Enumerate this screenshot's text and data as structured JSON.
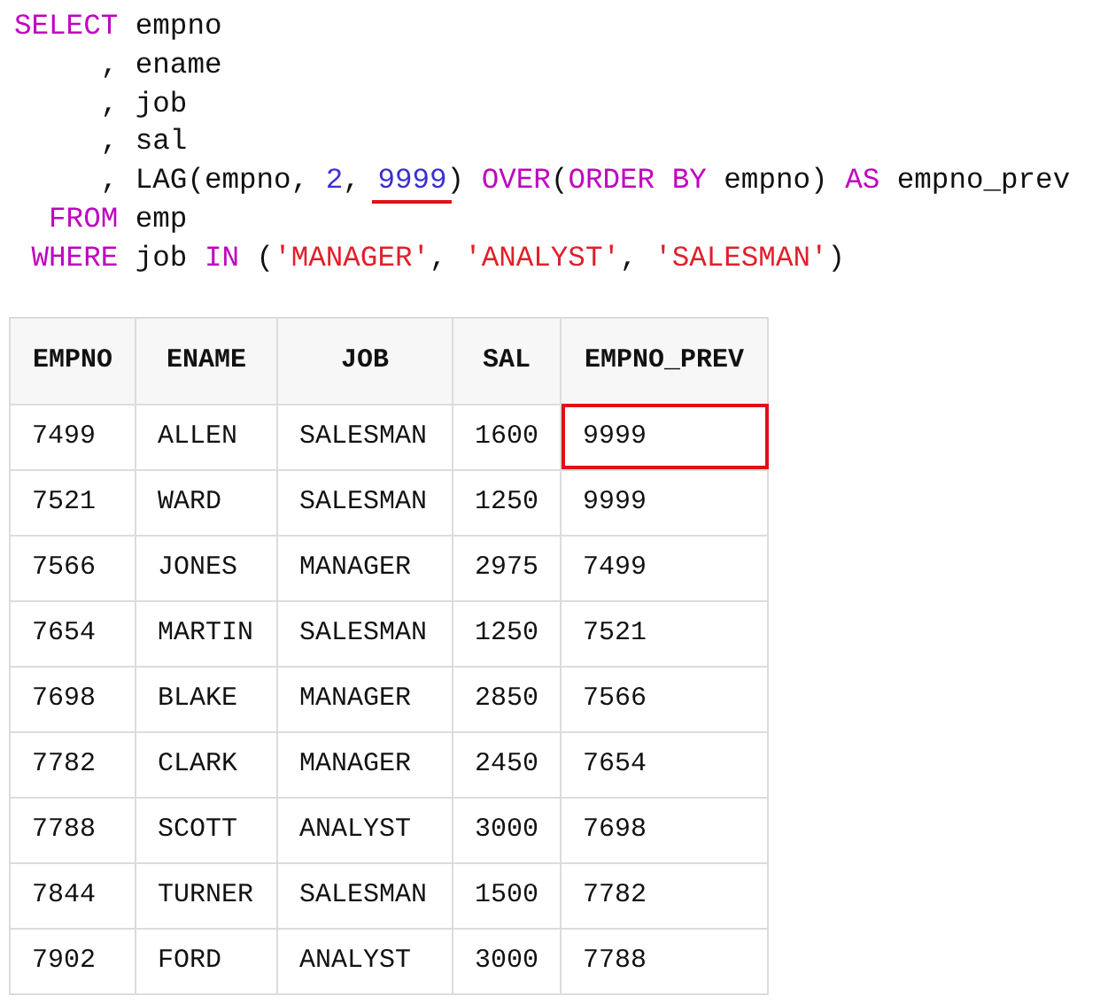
{
  "code": {
    "lines": [
      {
        "tokens": [
          {
            "kind": "keyword",
            "text": "SELECT"
          },
          {
            "kind": "plain",
            "text": " empno"
          }
        ]
      },
      {
        "tokens": [
          {
            "kind": "plain",
            "text": "     , ename"
          }
        ]
      },
      {
        "tokens": [
          {
            "kind": "plain",
            "text": "     , job"
          }
        ]
      },
      {
        "tokens": [
          {
            "kind": "plain",
            "text": "     , sal"
          }
        ]
      },
      {
        "tokens": [
          {
            "kind": "plain",
            "text": "     , LAG(empno, "
          },
          {
            "kind": "number",
            "text": "2"
          },
          {
            "kind": "plain",
            "text": ", "
          },
          {
            "kind": "number",
            "text": "9999",
            "underlined": true
          },
          {
            "kind": "plain",
            "text": ") "
          },
          {
            "kind": "keyword",
            "text": "OVER"
          },
          {
            "kind": "plain",
            "text": "("
          },
          {
            "kind": "keyword",
            "text": "ORDER BY"
          },
          {
            "kind": "plain",
            "text": " empno) "
          },
          {
            "kind": "keyword",
            "text": "AS"
          },
          {
            "kind": "plain",
            "text": " empno_prev"
          }
        ]
      },
      {
        "tokens": [
          {
            "kind": "keyword",
            "text": "  FROM"
          },
          {
            "kind": "plain",
            "text": " emp"
          }
        ]
      },
      {
        "tokens": [
          {
            "kind": "keyword",
            "text": " WHERE"
          },
          {
            "kind": "plain",
            "text": " job "
          },
          {
            "kind": "keyword",
            "text": "IN"
          },
          {
            "kind": "plain",
            "text": " ("
          },
          {
            "kind": "string",
            "text": "'MANAGER'"
          },
          {
            "kind": "plain",
            "text": ", "
          },
          {
            "kind": "string",
            "text": "'ANALYST'"
          },
          {
            "kind": "plain",
            "text": ", "
          },
          {
            "kind": "string",
            "text": "'SALESMAN'"
          },
          {
            "kind": "plain",
            "text": ")"
          }
        ]
      }
    ]
  },
  "table": {
    "columns": [
      "EMPNO",
      "ENAME",
      "JOB",
      "SAL",
      "EMPNO_PREV"
    ],
    "rows": [
      {
        "cells": [
          {
            "text": "7499"
          },
          {
            "text": "ALLEN"
          },
          {
            "text": "SALESMAN"
          },
          {
            "text": "1600"
          },
          {
            "text": "9999",
            "highlighted": true
          }
        ]
      },
      {
        "cells": [
          {
            "text": "7521"
          },
          {
            "text": "WARD"
          },
          {
            "text": "SALESMAN"
          },
          {
            "text": "1250"
          },
          {
            "text": "9999",
            "highlighted": false
          }
        ]
      },
      {
        "cells": [
          {
            "text": "7566"
          },
          {
            "text": "JONES"
          },
          {
            "text": "MANAGER"
          },
          {
            "text": "2975"
          },
          {
            "text": "7499",
            "highlighted": false
          }
        ]
      },
      {
        "cells": [
          {
            "text": "7654"
          },
          {
            "text": "MARTIN"
          },
          {
            "text": "SALESMAN"
          },
          {
            "text": "1250"
          },
          {
            "text": "7521",
            "highlighted": false
          }
        ]
      },
      {
        "cells": [
          {
            "text": "7698"
          },
          {
            "text": "BLAKE"
          },
          {
            "text": "MANAGER"
          },
          {
            "text": "2850"
          },
          {
            "text": "7566",
            "highlighted": false
          }
        ]
      },
      {
        "cells": [
          {
            "text": "7782"
          },
          {
            "text": "CLARK"
          },
          {
            "text": "MANAGER"
          },
          {
            "text": "2450"
          },
          {
            "text": "7654",
            "highlighted": false
          }
        ]
      },
      {
        "cells": [
          {
            "text": "7788"
          },
          {
            "text": "SCOTT"
          },
          {
            "text": "ANALYST"
          },
          {
            "text": "3000"
          },
          {
            "text": "7698",
            "highlighted": false
          }
        ]
      },
      {
        "cells": [
          {
            "text": "7844"
          },
          {
            "text": "TURNER"
          },
          {
            "text": "SALESMAN"
          },
          {
            "text": "1500"
          },
          {
            "text": "7782",
            "highlighted": false
          }
        ]
      },
      {
        "cells": [
          {
            "text": "7902"
          },
          {
            "text": "FORD"
          },
          {
            "text": "ANALYST"
          },
          {
            "text": "3000"
          },
          {
            "text": "7788",
            "highlighted": false
          }
        ]
      }
    ]
  }
}
